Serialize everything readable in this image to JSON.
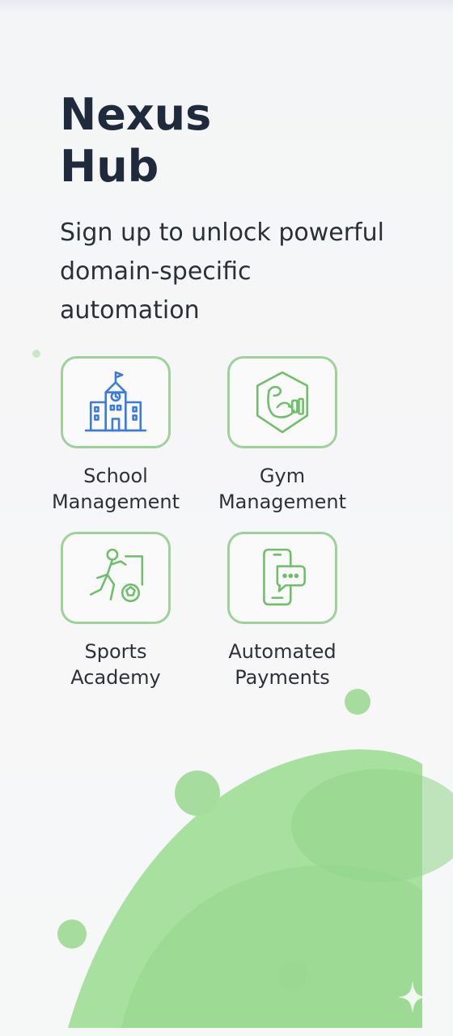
{
  "brand": {
    "line1": "Nexus",
    "line2": "Hub"
  },
  "subtitle": {
    "line1": "Sign up to unlock powerful",
    "line2": "domain-specific",
    "line3": "automation"
  },
  "features": [
    {
      "line1": "School",
      "line2": "Management",
      "icon": "school-building-icon"
    },
    {
      "line1": "Gym",
      "line2": "Management",
      "icon": "flexed-arm-icon"
    },
    {
      "line1": "Sports",
      "line2": "Academy",
      "icon": "soccer-player-icon"
    },
    {
      "line1": "Automated",
      "line2": "Payments",
      "icon": "phone-chat-icon"
    }
  ],
  "colors": {
    "title": "#1f2a3d",
    "tile_border": "#9fd19a",
    "icon_blue": "#3b7be0",
    "icon_green": "#6fbf6a",
    "blob_green": "#9fdc96"
  }
}
